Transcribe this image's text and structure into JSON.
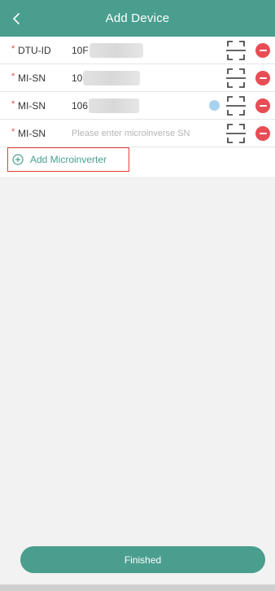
{
  "header": {
    "title": "Add Device",
    "back_icon": "chevron-left-icon"
  },
  "colors": {
    "brand": "#4a9e8e",
    "danger": "#e84c55",
    "required": "#e34b4b",
    "highlight_border": "#e03d3d"
  },
  "rows": [
    {
      "required_mark": "*",
      "label": "DTU-ID",
      "value_prefix": "10F",
      "placeholder": ""
    },
    {
      "required_mark": "*",
      "label": "MI-SN",
      "value_prefix": "10",
      "placeholder": ""
    },
    {
      "required_mark": "*",
      "label": "MI-SN",
      "value_prefix": "106",
      "placeholder": ""
    },
    {
      "required_mark": "*",
      "label": "MI-SN",
      "value_prefix": "",
      "placeholder": "Please enter microinverse SN"
    }
  ],
  "add_button": {
    "label": "Add Microinverter",
    "icon": "plus-circle-icon"
  },
  "footer": {
    "finish_label": "Finished"
  }
}
